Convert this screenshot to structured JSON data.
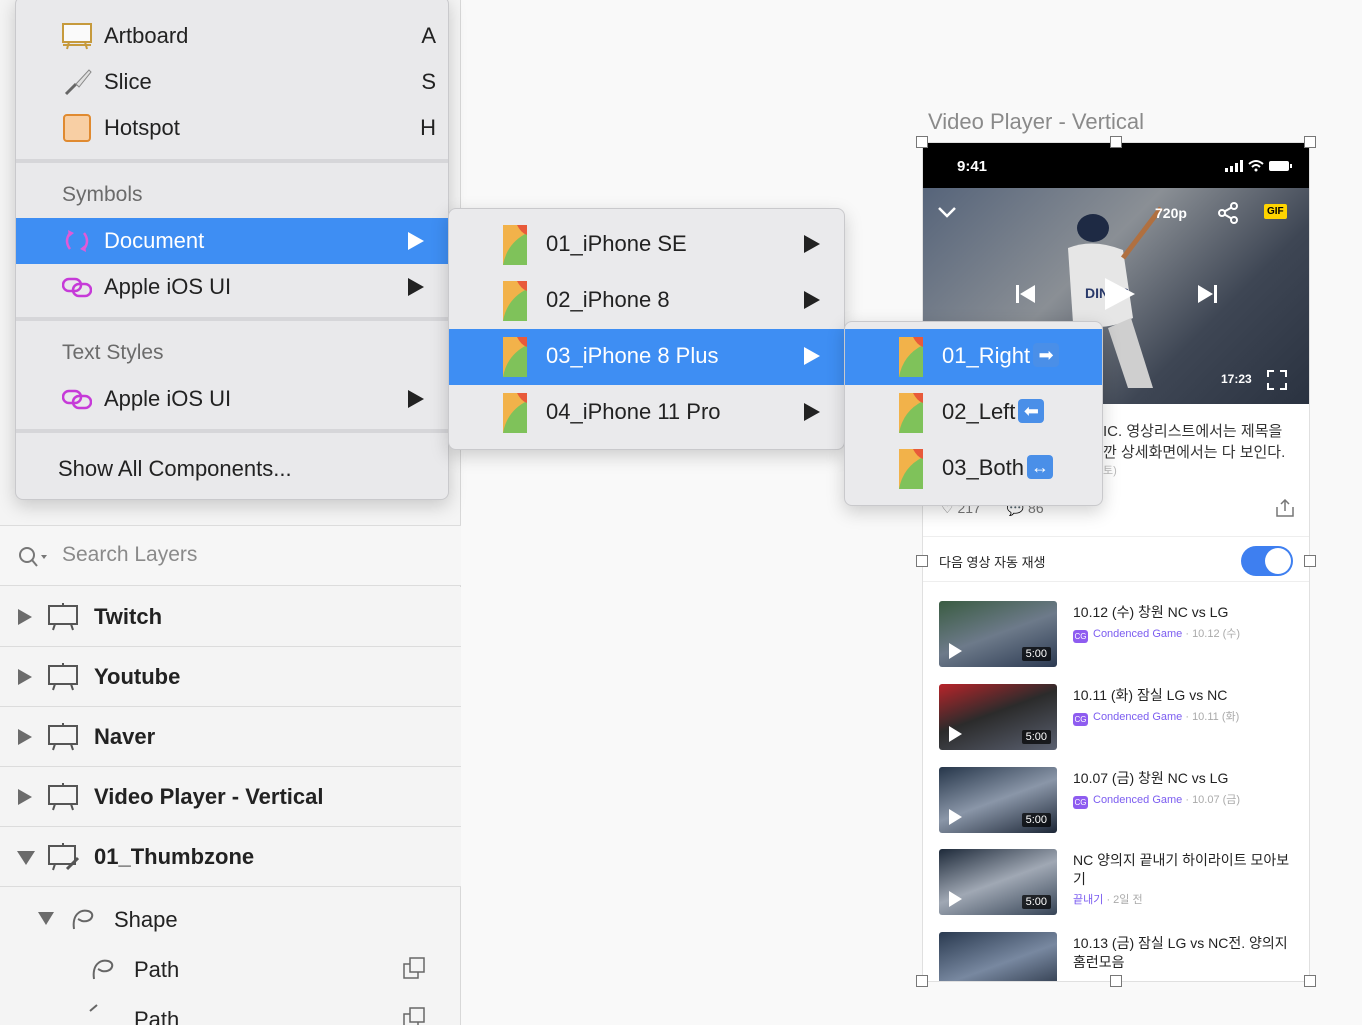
{
  "insert_menu": {
    "items_top": [
      {
        "label": "Artboard",
        "key": "A",
        "icon": "artboard-icon"
      },
      {
        "label": "Slice",
        "key": "S",
        "icon": "slice-knife-icon"
      },
      {
        "label": "Hotspot",
        "key": "H",
        "icon": "hotspot-icon"
      }
    ],
    "symbols_header": "Symbols",
    "symbols": [
      {
        "label": "Document",
        "icon": "sync-icon",
        "selected": true
      },
      {
        "label": "Apple iOS UI",
        "icon": "link-icon"
      }
    ],
    "text_styles_header": "Text Styles",
    "text_styles": [
      {
        "label": "Apple iOS UI",
        "icon": "link-icon"
      }
    ],
    "show_all": "Show All Components..."
  },
  "document_submenu": {
    "items": [
      {
        "label": "01_iPhone SE"
      },
      {
        "label": "02_iPhone 8"
      },
      {
        "label": "03_iPhone 8 Plus",
        "selected": true
      },
      {
        "label": "04_iPhone 11 Pro"
      }
    ]
  },
  "plus_submenu": {
    "items": [
      {
        "label": "01_Right",
        "arrow": "➡",
        "selected": true
      },
      {
        "label": "02_Left",
        "arrow": "⬅"
      },
      {
        "label": "03_Both",
        "arrow": "↔"
      }
    ]
  },
  "layers": {
    "search_placeholder": "Search Layers",
    "groups": [
      {
        "name": "Twitch"
      },
      {
        "name": "Youtube"
      },
      {
        "name": "Naver"
      },
      {
        "name": "Video Player - Vertical"
      },
      {
        "name": "01_Thumbzone",
        "expanded": true
      }
    ],
    "children": [
      {
        "name": "Shape"
      },
      {
        "name": "Path"
      },
      {
        "name": "Path"
      }
    ]
  },
  "artboard": {
    "title": "Video Player - Vertical",
    "status_time": "9:41",
    "quality": "720p",
    "gif_badge": "GIF",
    "duration": "17:23",
    "description_line1": "IC. 영상리스트에서는 제목을",
    "description_line2": "깐 상세화면에서는 다 보인다.",
    "description_line3": "토)",
    "likes": "217",
    "comments": "86",
    "autoplay_label": "다음 영상 자동 재생",
    "videos": [
      {
        "title": "10.12 (수) 창원 NC vs LG",
        "channel": "Condenced Game",
        "date": "· 10.12 (수)",
        "duration": "5:00"
      },
      {
        "title": "10.11 (화) 잠실 LG vs NC",
        "channel": "Condenced Game",
        "date": "· 10.11 (화)",
        "duration": "5:00"
      },
      {
        "title": "10.07 (금) 창원 NC vs LG",
        "channel": "Condenced Game",
        "date": "· 10.07 (금)",
        "duration": "5:00"
      },
      {
        "title": "NC 양의지 끝내기 하이라이트 모아보기",
        "channel": "끝내기",
        "date": "· 2일 전",
        "duration": "5:00"
      },
      {
        "title": "10.13 (금) 잠실 LG vs NC전. 양의지 홈런모음",
        "channel": "",
        "date": "",
        "duration": ""
      }
    ]
  },
  "colors": {
    "accent": "#3e8ef3",
    "toggle": "#3e7ff0",
    "channel": "#7b5cf0"
  }
}
